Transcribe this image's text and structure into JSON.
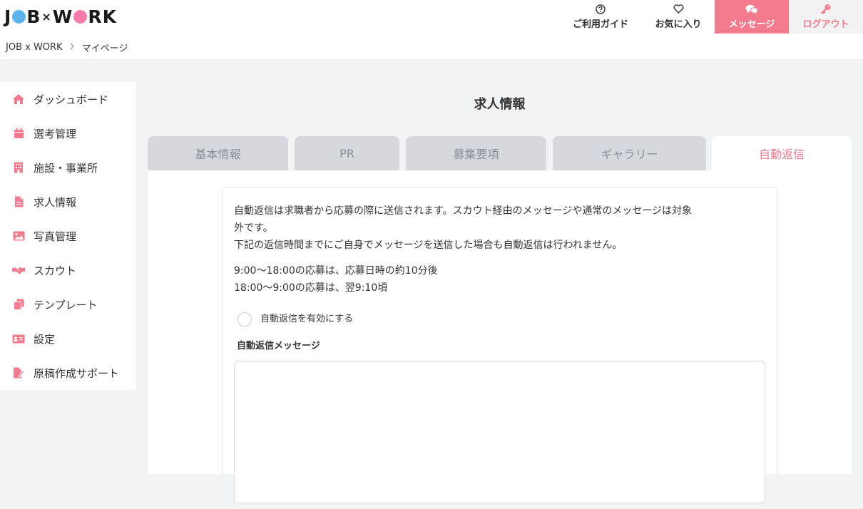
{
  "header": {
    "logo": {
      "j": "J",
      "b": "B",
      "x": "×",
      "w": "W",
      "rk": "RK"
    },
    "nav": {
      "guide": "ご利用ガイド",
      "favorites": "お気に入り",
      "messages": "メッセージ",
      "logout": "ログアウト"
    }
  },
  "breadcrumb": {
    "home": "JOB x WORK",
    "current": "マイページ"
  },
  "sidebar": {
    "items": [
      {
        "label": "ダッシュボード",
        "icon": "home-icon"
      },
      {
        "label": "選考管理",
        "icon": "calendar-icon"
      },
      {
        "label": "施設・事業所",
        "icon": "building-icon"
      },
      {
        "label": "求人情報",
        "icon": "document-icon"
      },
      {
        "label": "写真管理",
        "icon": "image-icon"
      },
      {
        "label": "スカウト",
        "icon": "handshake-icon"
      },
      {
        "label": "テンプレート",
        "icon": "copy-icon"
      },
      {
        "label": "設定",
        "icon": "id-card-icon"
      },
      {
        "label": "原稿作成サポート",
        "icon": "edit-document-icon"
      }
    ]
  },
  "page": {
    "title": "求人情報"
  },
  "tabs": {
    "basic": "基本情報",
    "pr": "PR",
    "requirements": "募集要項",
    "gallery": "ギャラリー",
    "auto_reply": "自動返信"
  },
  "auto_reply": {
    "line1": "自動返信は求職者から応募の際に送信されます。スカウト経由のメッセージや通常のメッセージは対象",
    "line2": "外です。",
    "line3": "下記の返信時間までにご自身でメッセージを送信した場合も自動返信は行われません。",
    "time1": "9:00〜18:00の応募は、応募日時の約10分後",
    "time2": "18:00〜9:00の応募は、翌9:10頃",
    "enable_label": "自動返信を有効にする",
    "enabled": false,
    "message_label": "自動返信メッセージ",
    "message_value": ""
  },
  "colors": {
    "accent": "#f47b8e",
    "tab_inactive": "#d5d8dd",
    "dot_blue": "#5ab4ea",
    "dot_pink": "#f47bab"
  }
}
